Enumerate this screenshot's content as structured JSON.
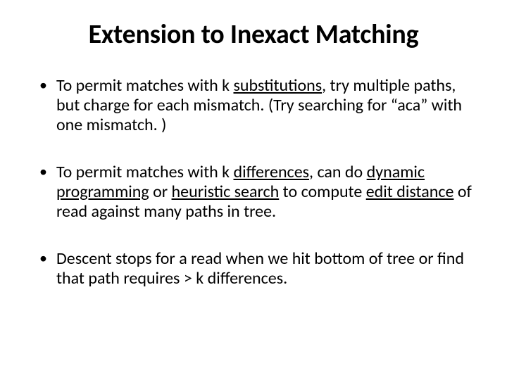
{
  "title": "Extension to Inexact Matching",
  "bullets": [
    {
      "pre": "To permit matches with k ",
      "u1": "substitutions",
      "post": ", try multiple paths, but charge for each mismatch. (Try searching for “aca” with one mismatch. )"
    },
    {
      "pre": "To permit matches with k ",
      "u1": "differences",
      "mid1": ", can do ",
      "u2": "dynamic programming",
      "mid2": " or ",
      "u3": "heuristic search",
      "mid3": " to compute ",
      "u4": "edit distance",
      "post": " of read against many paths in tree."
    },
    {
      "pre": "Descent stops for a read when we hit bottom of tree or find that path requires > k differences."
    }
  ]
}
